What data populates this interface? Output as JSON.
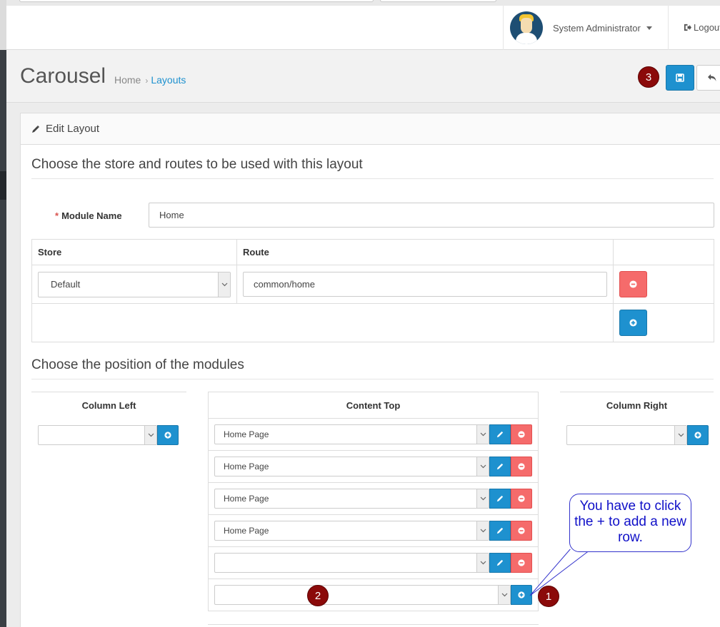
{
  "header": {
    "user_name": "System Administrator",
    "logout_label": "Logout"
  },
  "page": {
    "title": "Carousel",
    "breadcrumb": [
      "Home",
      "Layouts"
    ]
  },
  "annotations": {
    "badge_1": "1",
    "badge_2": "2",
    "badge_3": "3",
    "callout_text": "You have to click the + to add a new row."
  },
  "panel": {
    "heading": "Edit Layout",
    "legend_routes": "Choose the store and routes to be used with this layout",
    "module_name_label": "Module Name",
    "module_name_value": "Home",
    "routes_table": {
      "headers": [
        "Store",
        "Route",
        ""
      ],
      "rows": [
        {
          "store": "Default",
          "route": "common/home"
        }
      ]
    },
    "legend_positions": "Choose the position of the modules",
    "column_left": {
      "title": "Column Left",
      "selected": ""
    },
    "content_top": {
      "title": "Content Top",
      "rows": [
        "Home Page",
        "Home Page",
        "Home Page",
        "Home Page",
        ""
      ],
      "new_row_selected": ""
    },
    "column_right": {
      "title": "Column Right",
      "selected": ""
    }
  },
  "colors": {
    "primary": "#1e91cf",
    "danger": "#f56b6b",
    "badge": "#8b0a0a",
    "callout_text": "#1010c8"
  }
}
